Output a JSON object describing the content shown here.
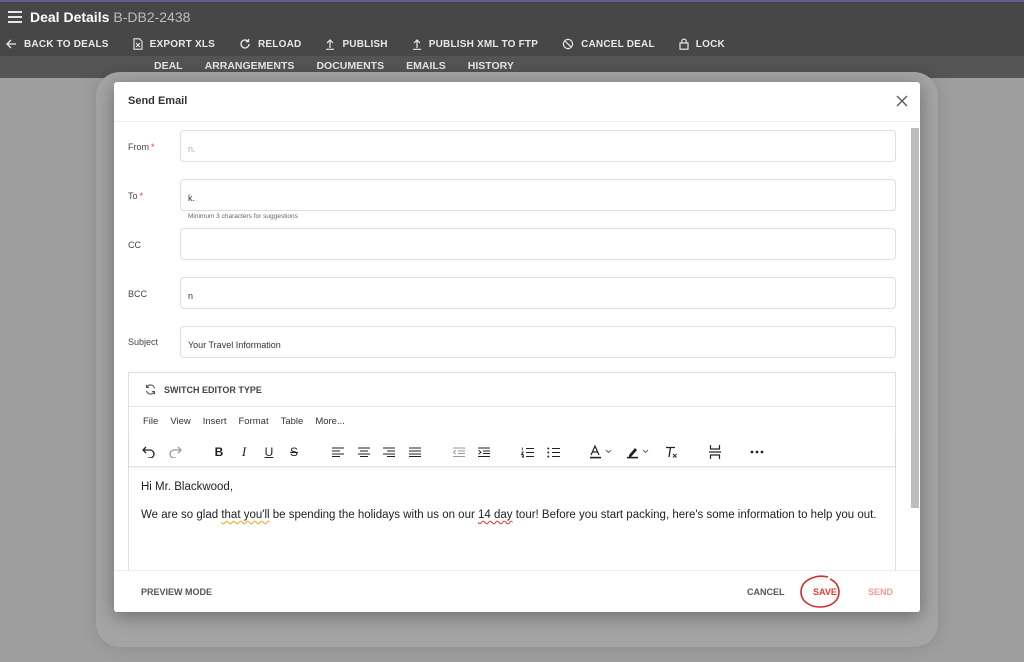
{
  "header": {
    "title": "Deal Details",
    "deal_id": "B-DB2-2438"
  },
  "toolbar": {
    "back": "BACK TO DEALS",
    "export": "EXPORT XLS",
    "reload": "RELOAD",
    "publish": "PUBLISH",
    "publish_xml": "PUBLISH XML TO FTP",
    "cancel_deal": "CANCEL DEAL",
    "lock": "LOCK"
  },
  "tabs": [
    {
      "label": "DEAL",
      "active": false
    },
    {
      "label": "ARRANGEMENTS",
      "active": false
    },
    {
      "label": "DOCUMENTS",
      "active": false
    },
    {
      "label": "EMAILS",
      "active": true
    },
    {
      "label": "HISTORY",
      "active": false
    }
  ],
  "dialog": {
    "title": "Send Email",
    "fields": {
      "from_label": "From",
      "from_value": "n.",
      "to_label": "To",
      "to_value": "k.",
      "to_hint": "Minimum 3 characters for suggestions",
      "cc_label": "CC",
      "cc_value": "",
      "bcc_label": "BCC",
      "bcc_value": "n",
      "subject_label": "Subject",
      "subject_value": "Your Travel Information",
      "required_mark": "*"
    },
    "editor": {
      "switch_label": "SWITCH EDITOR TYPE",
      "menu": [
        "File",
        "View",
        "Insert",
        "Format",
        "Table",
        "More..."
      ],
      "greeting": "Hi Mr. Blackwood,",
      "body_part1": "We are so glad ",
      "body_glad_that": "that you'll",
      "body_part2": " be spending the holidays with us on our ",
      "body_14day": "14 day",
      "body_part3": " tour! Before you start packing, here's some information to help you out."
    },
    "footer": {
      "preview": "PREVIEW MODE",
      "cancel": "CANCEL",
      "save": "SAVE",
      "send": "SEND"
    }
  },
  "colors": {
    "topbar": "#474747",
    "tabbar": "#555555",
    "accent_red": "#e53935",
    "send_disabled": "#ef9a9a"
  }
}
